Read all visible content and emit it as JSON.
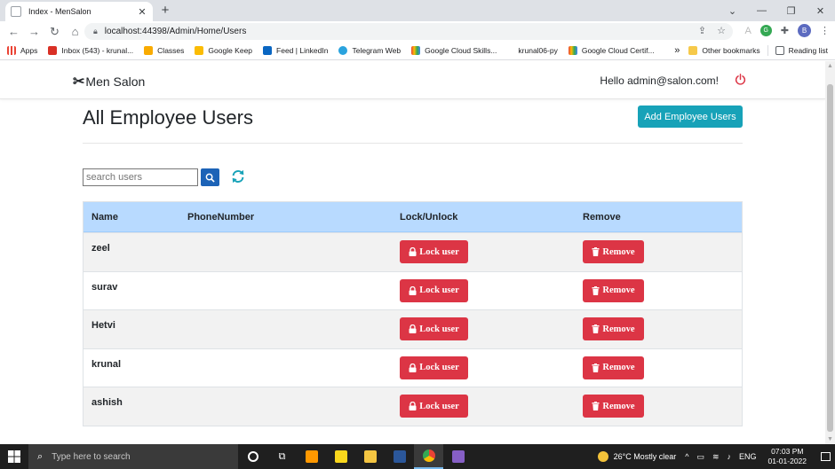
{
  "browser": {
    "tab_title": "Index - MenSalon",
    "url": "localhost:44398/Admin/Home/Users",
    "profile_initial": "B",
    "bookmarks": [
      {
        "label": "Apps",
        "color": "#ea4335"
      },
      {
        "label": "Inbox (543) - krunal...",
        "color": "#d93025"
      },
      {
        "label": "Classes",
        "color": "#f9ab00"
      },
      {
        "label": "Google Keep",
        "color": "#fbbc04"
      },
      {
        "label": "Feed | LinkedIn",
        "color": "#0a66c2"
      },
      {
        "label": "Telegram Web",
        "color": "#2aa3de"
      },
      {
        "label": "Google Cloud Skills...",
        "color": "#4285f4"
      },
      {
        "label": "krunal06-py",
        "color": "#ffffff"
      },
      {
        "label": "Google Cloud Certif...",
        "color": "#4285f4"
      }
    ],
    "bookmarks_overflow": "»",
    "other_bookmarks": "Other bookmarks",
    "reading_list": "Reading list"
  },
  "app": {
    "brand": "Men Salon",
    "greeting": "Hello admin@salon.com!",
    "page_title": "All Employee Users",
    "add_button": "Add Employee Users",
    "search_placeholder": "search users",
    "table": {
      "headers": [
        "Name",
        "PhoneNumber",
        "Lock/Unlock",
        "Remove"
      ],
      "rows": [
        {
          "name": "zeel",
          "phone": "",
          "lock_label": "Lock user",
          "remove_label": "Remove"
        },
        {
          "name": "surav",
          "phone": "",
          "lock_label": "Lock user",
          "remove_label": "Remove"
        },
        {
          "name": "Hetvi",
          "phone": "",
          "lock_label": "Lock user",
          "remove_label": "Remove"
        },
        {
          "name": "krunal",
          "phone": "",
          "lock_label": "Lock user",
          "remove_label": "Remove"
        },
        {
          "name": "ashish",
          "phone": "",
          "lock_label": "Lock user",
          "remove_label": "Remove"
        }
      ]
    },
    "colors": {
      "accent": "#17a2b8",
      "danger": "#dc3545",
      "table_header": "#b8daff",
      "search_button": "#1c63b7"
    }
  },
  "taskbar": {
    "search_placeholder": "Type here to search",
    "weather": "26°C  Mostly clear",
    "language": "ENG",
    "time": "07:03 PM",
    "date": "01-01-2022"
  }
}
